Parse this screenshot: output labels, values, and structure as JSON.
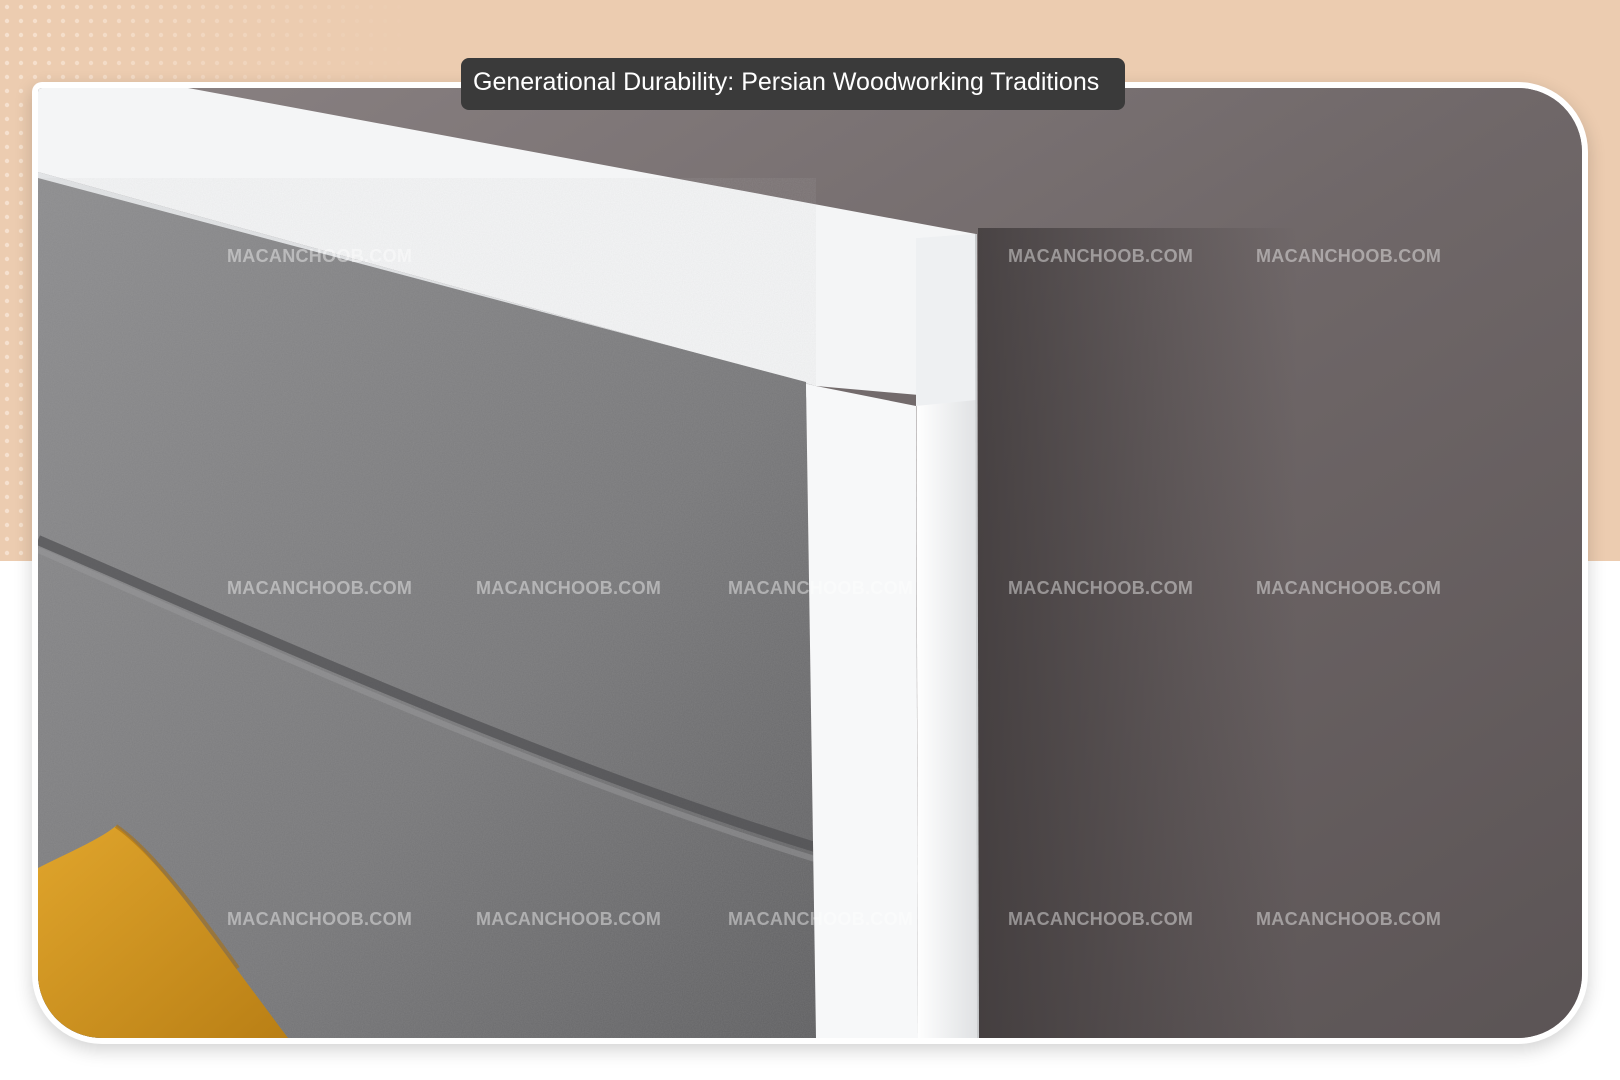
{
  "title": "Generational Durability: Persian Woodworking Traditions",
  "watermark": "MACANCHOOB.COM",
  "colors": {
    "background_band": "#ecccb0",
    "title_pill": "#3a3a3a",
    "wall": "#7b7374",
    "fabric": "#7e7e80",
    "frame": "#f4f5f6",
    "pillow": "#d49a25"
  }
}
